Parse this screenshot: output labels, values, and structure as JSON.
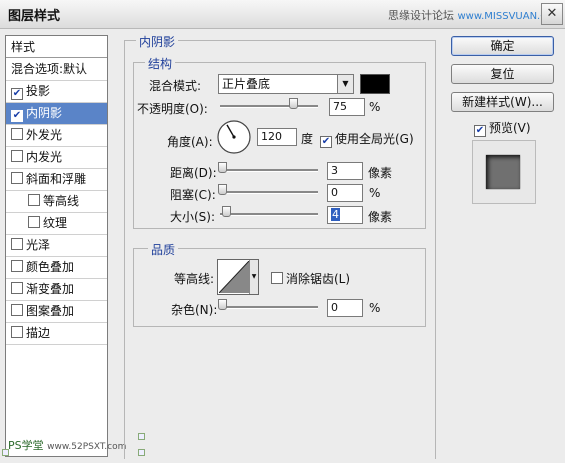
{
  "window": {
    "title": "图层样式",
    "watermark_cn": "思缘设计论坛",
    "watermark_url": "www.MISSVUAN.COM",
    "close_symbol": "✕"
  },
  "sidebar": {
    "header": "样式",
    "items": [
      {
        "label": "混合选项:默认",
        "checkbox": false,
        "checked": false,
        "selected": false,
        "sub": false
      },
      {
        "label": "投影",
        "checkbox": true,
        "checked": true,
        "selected": false,
        "sub": false
      },
      {
        "label": "内阴影",
        "checkbox": true,
        "checked": true,
        "selected": true,
        "sub": false
      },
      {
        "label": "外发光",
        "checkbox": true,
        "checked": false,
        "selected": false,
        "sub": false
      },
      {
        "label": "内发光",
        "checkbox": true,
        "checked": false,
        "selected": false,
        "sub": false
      },
      {
        "label": "斜面和浮雕",
        "checkbox": true,
        "checked": false,
        "selected": false,
        "sub": false
      },
      {
        "label": "等高线",
        "checkbox": true,
        "checked": false,
        "selected": false,
        "sub": true
      },
      {
        "label": "纹理",
        "checkbox": true,
        "checked": false,
        "selected": false,
        "sub": true
      },
      {
        "label": "光泽",
        "checkbox": true,
        "checked": false,
        "selected": false,
        "sub": false
      },
      {
        "label": "颜色叠加",
        "checkbox": true,
        "checked": false,
        "selected": false,
        "sub": false
      },
      {
        "label": "渐变叠加",
        "checkbox": true,
        "checked": false,
        "selected": false,
        "sub": false
      },
      {
        "label": "图案叠加",
        "checkbox": true,
        "checked": false,
        "selected": false,
        "sub": false
      },
      {
        "label": "描边",
        "checkbox": true,
        "checked": false,
        "selected": false,
        "sub": false
      }
    ],
    "footer_watermark": "PS学堂",
    "footer_url": "www.52PSXT.com"
  },
  "panel": {
    "title": "内阴影",
    "structure": {
      "title": "结构",
      "blend_mode_label": "混合模式:",
      "blend_mode_value": "正片叠底",
      "blend_color": "#000000",
      "opacity_label": "不透明度(O):",
      "opacity_value": "75",
      "opacity_unit": "%",
      "angle_label": "角度(A):",
      "angle_value": "120",
      "angle_unit": "度",
      "global_light_label": "使用全局光(G)",
      "global_light_checked": true,
      "distance_label": "距离(D):",
      "distance_value": "3",
      "distance_unit": "像素",
      "choke_label": "阻塞(C):",
      "choke_value": "0",
      "choke_unit": "%",
      "size_label": "大小(S):",
      "size_value": "4",
      "size_unit": "像素"
    },
    "quality": {
      "title": "品质",
      "contour_label": "等高线:",
      "antialias_label": "消除锯齿(L)",
      "antialias_checked": false,
      "noise_label": "杂色(N):",
      "noise_value": "0",
      "noise_unit": "%"
    }
  },
  "buttons": {
    "ok": "确定",
    "reset": "复位",
    "new_style": "新建样式(W)...",
    "preview_label": "预览(V)",
    "preview_checked": true
  }
}
